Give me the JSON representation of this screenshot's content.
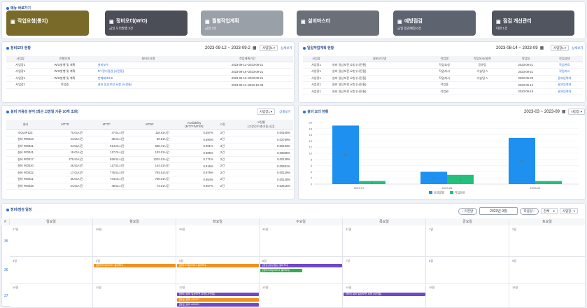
{
  "menu": {
    "title": "메뉴 바로가기",
    "cards": [
      {
        "title": "작업요청(통지)",
        "sub": "",
        "color": "#7a6a2a"
      },
      {
        "title": "정비오더(W/O)",
        "sub": "금일 오더발행 3건",
        "color": "#4b4e57"
      },
      {
        "title": "월별작업계획",
        "sub": "금일 3건",
        "color": "#9aa0a8"
      },
      {
        "title": "설비마스터",
        "sub": "",
        "color": "#6b6f77"
      },
      {
        "title": "예방점검",
        "sub": "금일 점검예정 0건",
        "color": "#5e6370"
      },
      {
        "title": "점검 개선관리",
        "sub": "미완 1건",
        "color": "#505560"
      }
    ]
  },
  "wo_panel": {
    "title": "정비오더 현황",
    "date_range": "2023-09-12 ~ 2023-09-2",
    "select": "사업장1",
    "more": "상세보기",
    "headers": [
      "사업장",
      "진행단계",
      "설비오더명",
      "작업계획기간"
    ],
    "rows": [
      [
        "사업장1",
        "W/O발행 및 계획",
        "설비보수",
        "2023-09-12~2023-09-21"
      ],
      [
        "사업장1",
        "W/O발행 및 계획",
        "P/I 정기점검 (사전통)",
        "2023-09-16~2023-09-21"
      ],
      [
        "사업장1",
        "W/O발행 및 계획",
        "판매제조3:8",
        "2023-09-19~2023-09-21"
      ],
      [
        "사업장1",
        "작업중",
        "설비 일상보전 요청 (사전통)",
        "2023-09-12~2023-10-09"
      ]
    ]
  },
  "plan_panel": {
    "title": "일일작업계획 현황",
    "date_range": "2023-08-14 ~ 2023-09",
    "select": "사업장1",
    "more": "상세보기",
    "headers": [
      "사업장",
      "설비오더명",
      "작업명",
      "작업유사/설계",
      "작업일",
      "작업상태"
    ],
    "rows": [
      [
        "사업장1",
        "설비 일상보전 요청 (사전통)",
        "작업요청",
        "공유팀",
        "2023-09-21",
        "작업완료"
      ],
      [
        "사업장1",
        "설비 일상보전 요청 (사전통)",
        "작업지시",
        "기술팀 A",
        "2023-09-21",
        "작업지시"
      ],
      [
        "사업장1",
        "설비 일상보전 요청 (사전통)",
        "작업지시",
        "기술팀 A",
        "2023-09-20",
        "결과입력대"
      ],
      [
        "사업장1",
        "설비 일상보전 요청 (사전통)",
        "작업중",
        "",
        "2023-09-14",
        "결과입력대"
      ],
      [
        "사업장1",
        "설비 일상보전 요청 (사전통)",
        "작업완",
        "",
        "2023-09-19",
        "결과입력대"
      ]
    ]
  },
  "analysis_panel": {
    "title": "설비 가용성 분석 (최근 고장일 기준 10개 조회)",
    "select": "사업장1",
    "more": "상세보기",
    "headers": [
      "설비",
      "MTTR",
      "MTTF",
      "MTBF",
      "Availability\n[MTTF/MTBF]",
      "고장",
      "고장률\n[고장건수/총가동시간]"
    ],
    "rows": [
      [
        "EQUIP123",
        "70.01시간",
        "47.61시간",
        "118.61시간",
        "0.397%",
        "2건",
        "0.00105%"
      ],
      [
        "설비 #00023",
        "24.51시간",
        "36.01시간",
        "60.51시간",
        "0.590%",
        "2건",
        "0.02759%"
      ],
      [
        "설비 #00021",
        "24.51시간",
        "614.01시간",
        "638.71시간",
        "0.961%",
        "3건",
        "0.00193%"
      ],
      [
        "설비 #00041",
        "15.01시간",
        "117.01시간",
        "132.01시간",
        "0.886%",
        "2건",
        "0.00855%"
      ],
      [
        "설비 #00017",
        "275.51시간",
        "826.51시간",
        "1202.01시간",
        "0.771%",
        "2건",
        "0.00138%"
      ],
      [
        "설비 #00020",
        "26.51시간",
        "117.51시간",
        "144.01시간",
        "0.816%",
        "2건",
        "0.00691%"
      ],
      [
        "설비 #00022",
        "17.01시간",
        "776.51시간",
        "793.51시간",
        "0.979%",
        "2건",
        "0.00129%"
      ],
      [
        "설비 #00021",
        "36.01시간",
        "744.01시간",
        "780.01시간",
        "0.954%",
        "2건",
        "0.00128%"
      ],
      [
        "설비 #00028",
        "24.51시간",
        "48.51시간",
        "72.01시간",
        "0.667%",
        "2건",
        "0.02515%"
      ]
    ]
  },
  "chart_panel": {
    "title": "설비 오더 현황",
    "date_range": "2023-03 ~ 2023-09",
    "select": "사업장"
  },
  "chart_data": {
    "type": "bar",
    "categories": [
      "2023-07",
      "2023-08",
      "2023-09"
    ],
    "series": [
      {
        "name": "요청발행",
        "values": [
          19,
          4,
          15
        ],
        "color": "#1e90f0"
      },
      {
        "name": "작업완료",
        "values": [
          1,
          3,
          1
        ],
        "color": "#22c07a"
      }
    ],
    "ylim": [
      0,
      20
    ],
    "yticks": [
      0,
      2,
      4,
      6,
      8,
      10,
      12,
      14,
      16,
      18,
      20
    ],
    "legend": "bottom"
  },
  "calendar": {
    "title": "정비/점검 일정",
    "prev": "이전달",
    "month": "2023년 9월",
    "next": "다음달",
    "view": "전체",
    "select": "사업장",
    "weekday_headers": [
      "#",
      "일요일",
      "월요일",
      "화요일",
      "수요일",
      "목요일",
      "금요일",
      "토요일"
    ],
    "weeks": [
      {
        "num": "35",
        "days": [
          "27일",
          "28일",
          "29일",
          "30일",
          "31일",
          "1일",
          "2일"
        ]
      },
      {
        "num": "36",
        "days": [
          "3일",
          "4일",
          "5일",
          "6일",
          "7일",
          "8일",
          "9일"
        ]
      },
      {
        "num": "37",
        "days": [
          "10일",
          "11일",
          "12일",
          "13일",
          "14일",
          "15일",
          "16일"
        ]
      }
    ],
    "events": [
      {
        "label": "[정비오더]00001 설비보수",
        "color": "#f0921e"
      },
      {
        "label": "[정비오더]00001 설비보수",
        "color": "#f0921e"
      },
      {
        "label": "[점검] 일상점검 설비보수",
        "color": "#7048c8"
      },
      {
        "label": "[정비오더]00001 설비보수",
        "color": "#2fae4a"
      },
      {
        "label": "[정비] 설비 일상보전 요청 (사전통)",
        "color": "#7048c8"
      },
      {
        "label": "[점검] 설비 #00001",
        "color": "#f0921e"
      },
      {
        "label": "[점검] 설비 #00001",
        "color": "#7048c8"
      },
      {
        "label": "[정비] 설비 일상보전 요청 (사전통)",
        "color": "#7048c8"
      }
    ]
  }
}
